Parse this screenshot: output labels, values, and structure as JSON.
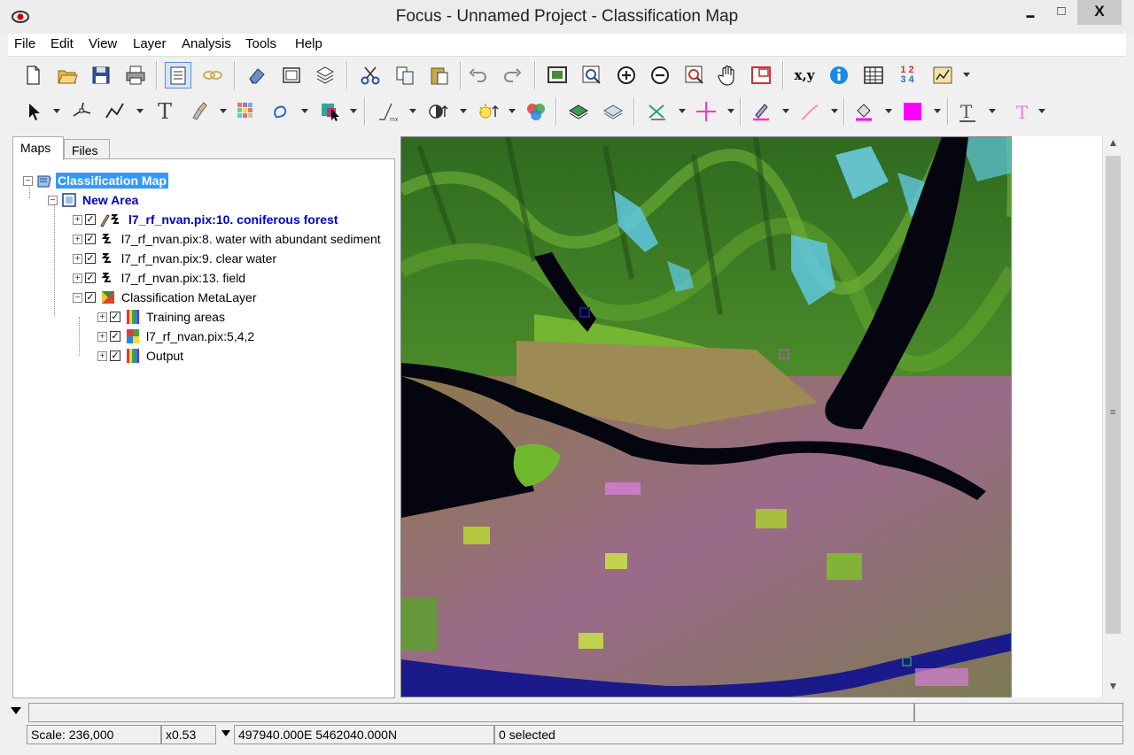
{
  "window": {
    "title": "Focus - Unnamed Project - Classification Map",
    "minimize_glyph": "▬",
    "maximize_glyph": "□",
    "close_glyph": "X"
  },
  "menu": [
    "File",
    "Edit",
    "View",
    "Layer",
    "Analysis",
    "Tools",
    "Help"
  ],
  "toolbar1": {
    "icons": [
      "new-file-icon",
      "open-folder-icon",
      "save-icon",
      "print-icon",
      "properties-icon",
      "link-icon",
      "eraser-icon",
      "window-icon",
      "layers-stack-icon",
      "cut-icon",
      "copy-icon",
      "paste-icon",
      "undo-icon",
      "redo-icon",
      "zoom-extent-icon",
      "zoom-window-icon",
      "zoom-in-icon",
      "zoom-out-icon",
      "zoom-layer-icon",
      "pan-hand-icon",
      "overview-icon",
      "xy-coordinate-icon",
      "info-icon",
      "table-icon",
      "numbers-icon",
      "chart-icon"
    ],
    "xy_label": "x,y",
    "numbers_label_top": "1 2",
    "numbers_label_bottom": "3 4"
  },
  "toolbar2": {
    "icons": [
      "select-arrow-icon",
      "node-edit-icon",
      "polyline-icon",
      "text-tool-icon",
      "brush-icon",
      "grid-icon",
      "lasso-icon",
      "fill-select-icon",
      "line-style-icon",
      "contrast-icon",
      "brightness-icon",
      "color-balance-icon",
      "layer-up-icon",
      "layer-down-icon",
      "mark-icon",
      "crosshair-icon",
      "pen-icon",
      "line-color-icon",
      "fill-color-icon",
      "font-color-icon",
      "text-color-icon"
    ],
    "text_tool_label": "T",
    "accent_magenta": "#ff00ff"
  },
  "left_panel": {
    "tabs": [
      "Maps",
      "Files"
    ],
    "active_tab": "Maps",
    "tree": {
      "root": "Classification Map",
      "area": "New Area",
      "layers": [
        {
          "label": "l7_rf_nvan.pix:10. coniferous forest",
          "checked": true,
          "active": true
        },
        {
          "label": "l7_rf_nvan.pix:8. water with abundant sediment",
          "checked": true
        },
        {
          "label": "l7_rf_nvan.pix:9. clear water",
          "checked": true
        },
        {
          "label": "l7_rf_nvan.pix:13. field",
          "checked": true
        }
      ],
      "meta_layer": "Classification MetaLayer",
      "meta_children": [
        {
          "label": "Training areas",
          "checked": true
        },
        {
          "label": "l7_rf_nvan.pix:5,4,2",
          "checked": true
        },
        {
          "label": "Output",
          "checked": true
        }
      ]
    }
  },
  "status": {
    "scale": "Scale: 236,000",
    "zoom": "x0.53",
    "coords": "497940.000E 5462040.000N",
    "selection": "0 selected"
  },
  "colors": {
    "selection_blue": "#3399ff",
    "active_layer_text": "#0000cc"
  }
}
